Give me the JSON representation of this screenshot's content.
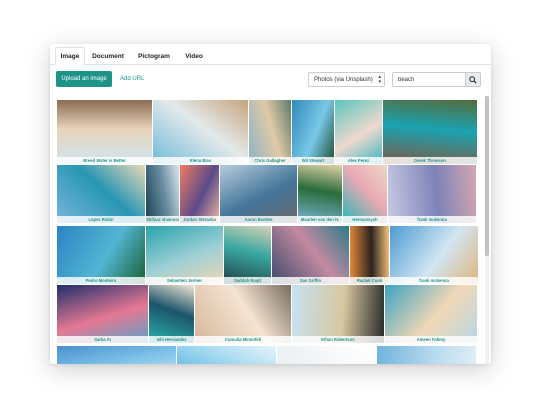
{
  "tabs": [
    {
      "label": "Image",
      "active": true
    },
    {
      "label": "Document",
      "active": false
    },
    {
      "label": "Pictogram",
      "active": false
    },
    {
      "label": "Video",
      "active": false
    }
  ],
  "toolbar": {
    "upload_label": "Upload an image",
    "add_url_label": "Add URL",
    "source_select_value": "Photos (via Unsplash)",
    "search_value": "beach",
    "search_icon": "search-icon"
  },
  "colors": {
    "accent": "#1e9488"
  },
  "images": [
    {
      "caption": "Breed Water is Better",
      "palette": [
        "#cfe6f1",
        "#e8d3b9",
        "#8a6b53"
      ]
    },
    {
      "caption": "Elena Bias",
      "palette": [
        "#6fb9da",
        "#e3eaea",
        "#c7a47e"
      ]
    },
    {
      "caption": "Chris Gallagher",
      "palette": [
        "#8ab4c8",
        "#e0c9a6",
        "#5c7c6c"
      ]
    },
    {
      "caption": "Wil Stewart",
      "palette": [
        "#2f89b8",
        "#79c8e8",
        "#1f4d33"
      ]
    },
    {
      "caption": "Alex Perez",
      "palette": [
        "#59c6be",
        "#eed9ce",
        "#3ab5c2"
      ]
    },
    {
      "caption": "Derek Thomson",
      "palette": [
        "#7d5a45",
        "#1aa3b1",
        "#556c3d"
      ]
    },
    {
      "caption": "Lopez Robin",
      "palette": [
        "#78b6dd",
        "#2896b3",
        "#e8d9b6"
      ]
    },
    {
      "caption": "Shifaaz shamoon",
      "palette": [
        "#193f52",
        "#6a8ea1",
        "#dbe6ec"
      ]
    },
    {
      "caption": "Jordan Steranka",
      "palette": [
        "#f27b63",
        "#5b4a8a",
        "#f3b6a1"
      ]
    },
    {
      "caption": "Aaron Burden",
      "palette": [
        "#b6ccdb",
        "#43759a",
        "#6a6a6a"
      ]
    },
    {
      "caption": "Maarten van den H.",
      "palette": [
        "#7ab5d6",
        "#2a6c3b",
        "#e1d2a9"
      ]
    },
    {
      "caption": "Hermansyah",
      "palette": [
        "#23b8b5",
        "#e9a9b4",
        "#eed8c8"
      ]
    },
    {
      "caption": "frank mckenna",
      "palette": [
        "#c7c9e3",
        "#7d83b8",
        "#d4a7b0"
      ]
    },
    {
      "caption": "Pedro Monteiro",
      "palette": [
        "#2b84c4",
        "#52b5d3",
        "#1a5f32"
      ]
    },
    {
      "caption": "Sebastien Jermer",
      "palette": [
        "#2aa2ad",
        "#9ed0d5",
        "#f0d6b2"
      ]
    },
    {
      "caption": "Saddah Ruqit",
      "palette": [
        "#1f3f46",
        "#39a7a1",
        "#d7d2b6"
      ]
    },
    {
      "caption": "Sav Griffin",
      "palette": [
        "#3a4a6a",
        "#c38aa1",
        "#2c7b89"
      ]
    },
    {
      "caption": "Rachel Cook",
      "palette": [
        "#e58a3a",
        "#2c2320",
        "#f3c27a"
      ]
    },
    {
      "caption": "frank mckenna",
      "palette": [
        "#4b9bd1",
        "#d1e6f2",
        "#e0b37c"
      ]
    },
    {
      "caption": "Sarka AI",
      "palette": [
        "#1e2f6a",
        "#e57893",
        "#5aa2c9"
      ]
    },
    {
      "caption": "Ishi Hernandez",
      "palette": [
        "#2bb3b0",
        "#1c556a",
        "#f2e6d6"
      ]
    },
    {
      "caption": "Cumulia Minnofeli",
      "palette": [
        "#d6b79a",
        "#f4e4d2",
        "#7a6c5f"
      ]
    },
    {
      "caption": "Ethan Robertson",
      "palette": [
        "#c6e2f2",
        "#d7c7a0",
        "#2a2a2a"
      ]
    },
    {
      "caption": "Ameen Fahmy",
      "palette": [
        "#3aa3c2",
        "#f1d8b6",
        "#b7d7e4"
      ]
    },
    {
      "caption": "",
      "palette": [
        "#4a8fcf",
        "#7fc4e8",
        "#c5e3f3"
      ]
    },
    {
      "caption": "",
      "palette": [
        "#5bb4e4",
        "#a9dcf1",
        "#e7f3f9"
      ]
    },
    {
      "caption": "",
      "palette": [
        "#e8eef2",
        "#f6f8fa",
        "#ffffff"
      ]
    },
    {
      "caption": "",
      "palette": [
        "#6fb3db",
        "#b6d9ee",
        "#e2eff7"
      ]
    }
  ]
}
